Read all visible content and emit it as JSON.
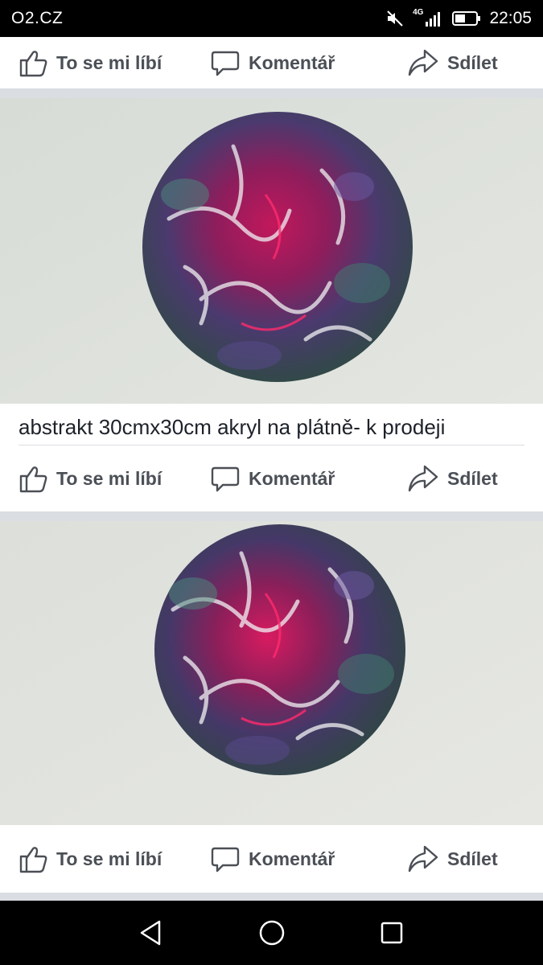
{
  "status_bar": {
    "carrier": "O2.CZ",
    "network": "4G",
    "time": "22:05",
    "icons": [
      "mute-icon",
      "signal-icon",
      "battery-icon"
    ]
  },
  "actions": {
    "like": "To se mi líbí",
    "comment": "Komentář",
    "share": "Sdílet"
  },
  "posts": [
    {
      "caption": "abstrakt 30cmx30cm akryl na plátně- k prodeji"
    }
  ],
  "nav_bar": {
    "icons": [
      "back-icon",
      "home-icon",
      "recents-icon"
    ]
  },
  "colors": {
    "text": "#4b4f56",
    "caption": "#1d2129",
    "divider": "#dadde1",
    "wall": "#dfe2dc"
  }
}
